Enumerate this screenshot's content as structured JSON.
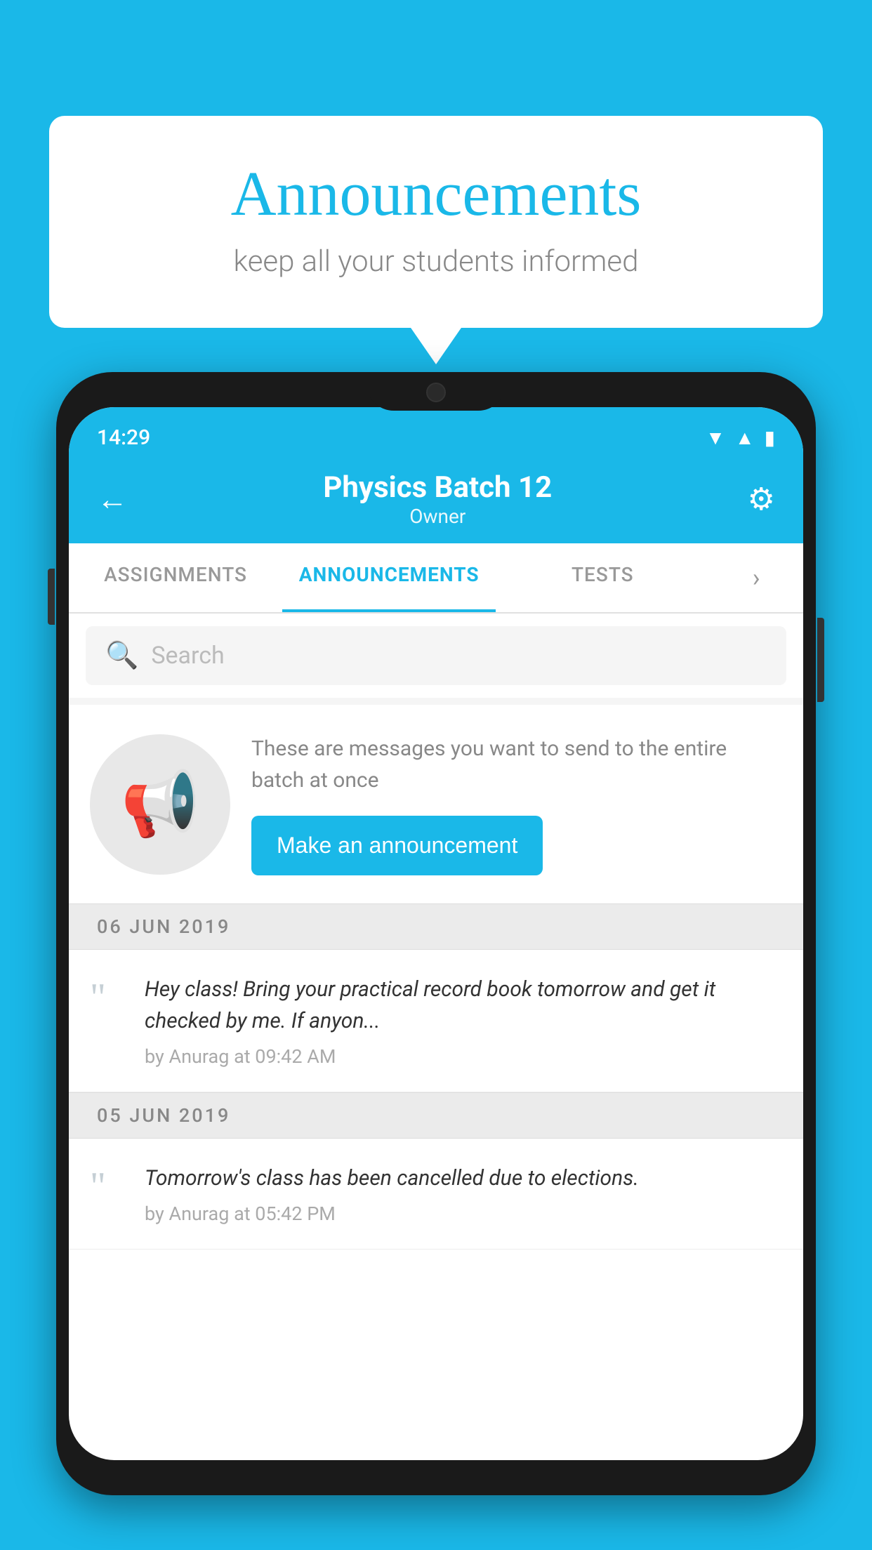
{
  "background_color": "#1ab8e8",
  "speech_bubble": {
    "title": "Announcements",
    "subtitle": "keep all your students informed"
  },
  "phone": {
    "status_bar": {
      "time": "14:29",
      "icons": [
        "wifi",
        "signal",
        "battery"
      ]
    },
    "header": {
      "title": "Physics Batch 12",
      "subtitle": "Owner",
      "back_label": "←",
      "settings_label": "⚙"
    },
    "tabs": [
      {
        "label": "ASSIGNMENTS",
        "active": false
      },
      {
        "label": "ANNOUNCEMENTS",
        "active": true
      },
      {
        "label": "TESTS",
        "active": false
      }
    ],
    "search": {
      "placeholder": "Search"
    },
    "promo_card": {
      "description": "These are messages you want to send to the entire batch at once",
      "button_label": "Make an announcement"
    },
    "announcements": [
      {
        "date": "06  JUN  2019",
        "text": "Hey class! Bring your practical record book tomorrow and get it checked by me. If anyon...",
        "meta": "by Anurag at 09:42 AM"
      },
      {
        "date": "05  JUN  2019",
        "text": "Tomorrow's class has been cancelled due to elections.",
        "meta": "by Anurag at 05:42 PM"
      }
    ]
  }
}
